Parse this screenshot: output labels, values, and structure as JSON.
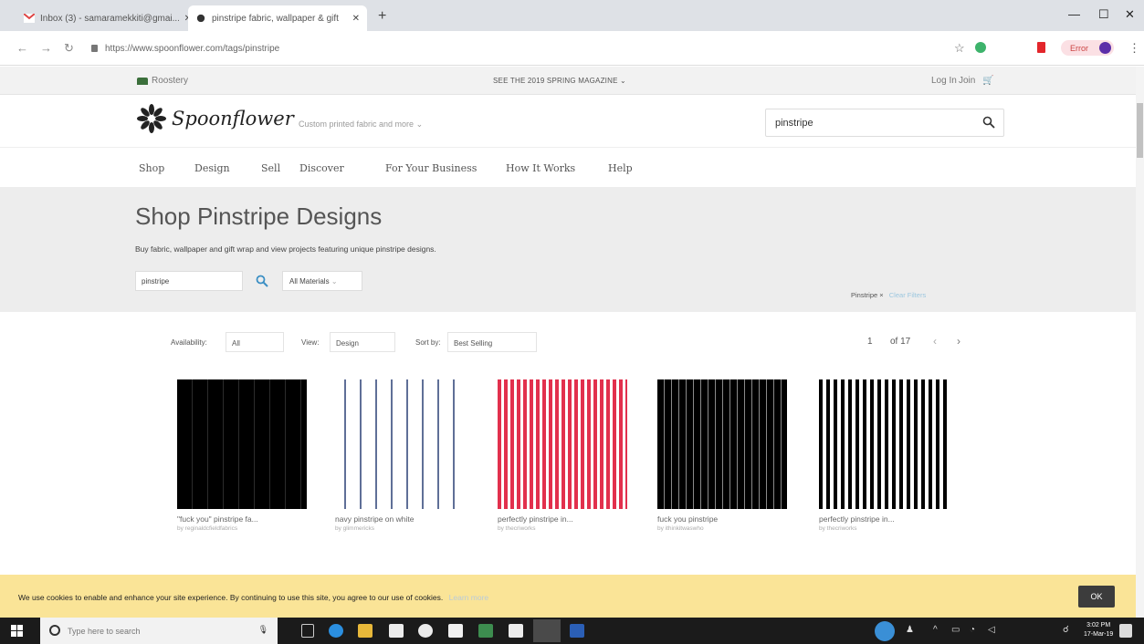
{
  "browser": {
    "tabs": [
      {
        "title": "Inbox (3) - samaramekkiti@gmai..."
      },
      {
        "title": "pinstripe fabric, wallpaper & gift"
      }
    ],
    "url": "https://www.spoonflower.com/tags/pinstripe",
    "profile_label": "Error"
  },
  "topbar": {
    "brand": "Roostery",
    "promo": "SEE THE 2019 SPRING MAGAZINE",
    "login": "Log In",
    "join": "Join"
  },
  "header": {
    "logo_text": "Spoonflower",
    "tagline": "Custom printed fabric and more",
    "search_value": "pinstripe"
  },
  "nav": [
    "Shop",
    "Design",
    "Sell",
    "Discover",
    "For Your Business",
    "How It Works",
    "Help"
  ],
  "hero": {
    "title": "Shop Pinstripe Designs",
    "description": "Buy fabric, wallpaper and gift wrap and view projects featuring unique pinstripe designs.",
    "keyword": "pinstripe",
    "materials": "All Materials",
    "active_filter": "Pinstripe",
    "clear_filters": "Clear Filters"
  },
  "toolbar": {
    "availability_label": "Availability:",
    "availability_value": "All",
    "view_label": "View:",
    "view_value": "Design",
    "sort_label": "Sort by:",
    "sort_value": "Best Selling",
    "page": "1",
    "page_total": "of 17"
  },
  "products": [
    {
      "name": "\"fuck you\" pinstripe fa...",
      "by": "by reginaldcfieldfabrics"
    },
    {
      "name": "navy pinstripe on white",
      "by": "by glimmericks"
    },
    {
      "name": "perfectly pinstripe in...",
      "by": "by thecriworks"
    },
    {
      "name": "fuck you pinstripe",
      "by": "by ithinkitwaswho"
    },
    {
      "name": "perfectly pinstripe in...",
      "by": "by thecriworks"
    }
  ],
  "cookie": {
    "message": "We use cookies to enable and enhance your site experience. By continuing to use this site, you agree to our use of cookies.",
    "learn_more": "Learn more",
    "ok": "OK"
  },
  "taskbar": {
    "search_placeholder": "Type here to search",
    "time": "3:02 PM",
    "date": "17-Mar-19"
  },
  "colors": {
    "cookie_bg": "#fae497",
    "stripe_red": "#e2304d",
    "stripe_navy": "#5f6f97"
  }
}
